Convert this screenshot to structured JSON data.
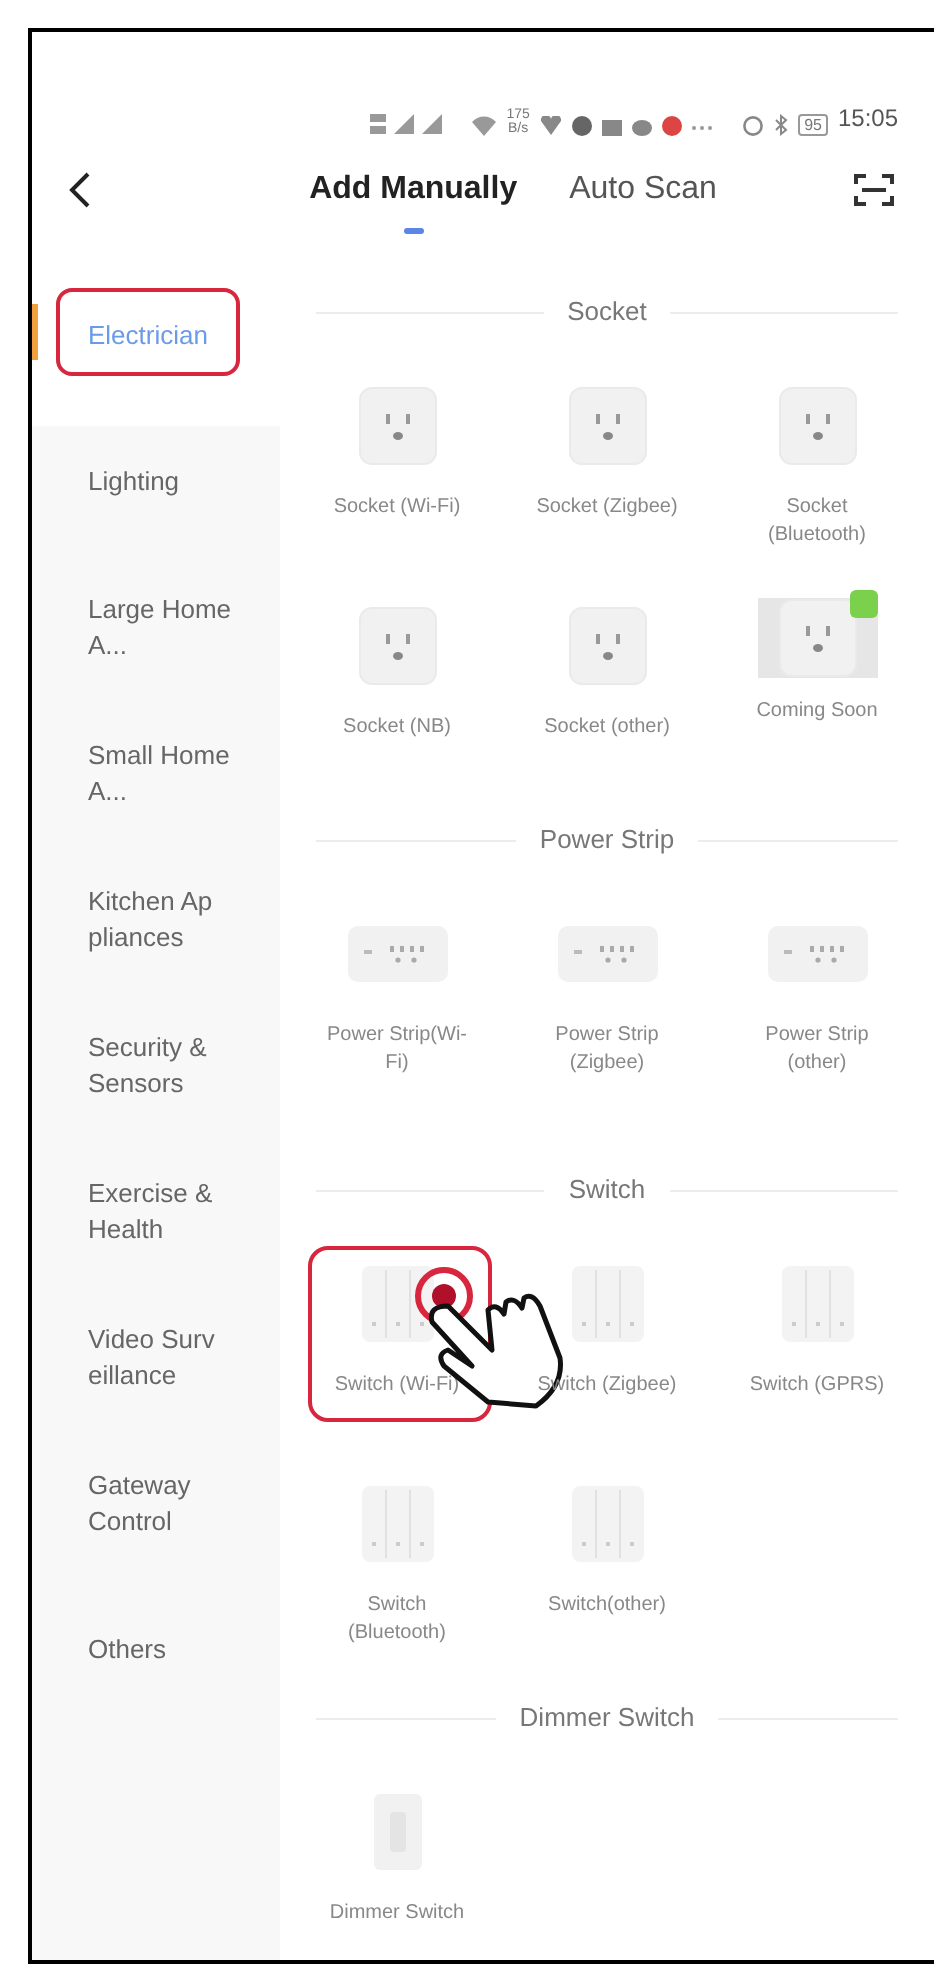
{
  "status_bar": {
    "speed": "175 B/s",
    "battery": "95",
    "time": "15:05"
  },
  "nav": {
    "tabs": [
      {
        "label": "Add Manually",
        "selected": true
      },
      {
        "label": "Auto Scan",
        "selected": false
      }
    ]
  },
  "sidebar": {
    "items": [
      {
        "label": "Electrician",
        "selected": true,
        "highlighted": true
      },
      {
        "label": "Lighting",
        "selected": false,
        "highlighted": false
      },
      {
        "label": "Large Home A...",
        "selected": false,
        "highlighted": false
      },
      {
        "label": "Small Home A...",
        "selected": false,
        "highlighted": false
      },
      {
        "label": "Kitchen Ap pliances",
        "selected": false,
        "highlighted": false
      },
      {
        "label": "Security & Sensors",
        "selected": false,
        "highlighted": false
      },
      {
        "label": "Exercise & Health",
        "selected": false,
        "highlighted": false
      },
      {
        "label": "Video Surv eillance",
        "selected": false,
        "highlighted": false
      },
      {
        "label": "Gateway Control",
        "selected": false,
        "highlighted": false
      },
      {
        "label": "Others",
        "selected": false,
        "highlighted": false
      }
    ]
  },
  "sections": [
    {
      "title": "Socket",
      "devices": [
        {
          "label": "Socket (Wi-Fi)",
          "kind": "socket",
          "badge": false,
          "highlighted": false
        },
        {
          "label": "Socket (Zigbee)",
          "kind": "socket",
          "badge": false,
          "highlighted": false
        },
        {
          "label": "Socket (Bluetooth)",
          "kind": "socket",
          "badge": false,
          "highlighted": false
        },
        {
          "label": "Socket (NB)",
          "kind": "socket",
          "badge": false,
          "highlighted": false
        },
        {
          "label": "Socket (other)",
          "kind": "socket",
          "badge": false,
          "highlighted": false
        },
        {
          "label": "Coming Soon",
          "kind": "socket",
          "badge": true,
          "highlighted": false
        }
      ]
    },
    {
      "title": "Power Strip",
      "devices": [
        {
          "label": "Power Strip(Wi-Fi)",
          "kind": "strip",
          "badge": false,
          "highlighted": false
        },
        {
          "label": "Power Strip (Zigbee)",
          "kind": "strip",
          "badge": false,
          "highlighted": false
        },
        {
          "label": "Power Strip (other)",
          "kind": "strip",
          "badge": false,
          "highlighted": false
        }
      ]
    },
    {
      "title": "Switch",
      "devices": [
        {
          "label": "Switch (Wi-Fi)",
          "kind": "switch",
          "badge": false,
          "highlighted": true
        },
        {
          "label": "Switch (Zigbee)",
          "kind": "switch",
          "badge": false,
          "highlighted": false
        },
        {
          "label": "Switch (GPRS)",
          "kind": "switch",
          "badge": false,
          "highlighted": false
        },
        {
          "label": "Switch (Bluetooth)",
          "kind": "switch",
          "badge": false,
          "highlighted": false
        },
        {
          "label": "Switch(other)",
          "kind": "switch",
          "badge": false,
          "highlighted": false
        }
      ]
    },
    {
      "title": "Dimmer Switch",
      "devices": [
        {
          "label": "Dimmer Switch",
          "kind": "dimmer",
          "badge": false,
          "highlighted": false
        }
      ]
    }
  ]
}
